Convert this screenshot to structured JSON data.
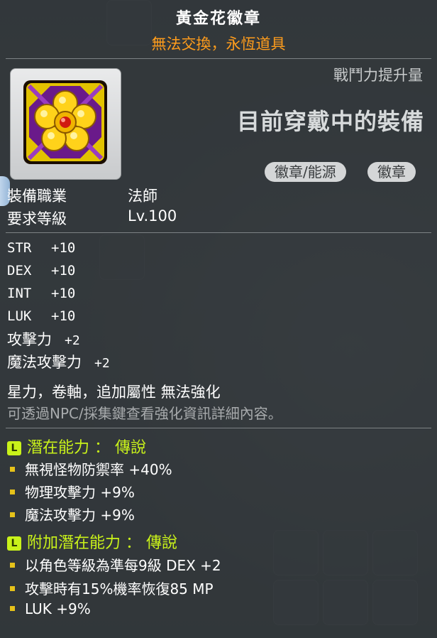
{
  "item": {
    "name": "黃金花徽章",
    "trade_note": "無法交換，永恆道具",
    "combat_power_label": "戰鬥力提升量",
    "equipped_label": "目前穿戴中的裝備",
    "tags": [
      "徽章/能源",
      "徽章"
    ]
  },
  "requirements": {
    "job_label": "裝備職業",
    "job_value": "法師",
    "level_label": "要求等級",
    "level_value": "Lv.100"
  },
  "stats": [
    {
      "name": "STR",
      "value": "+10"
    },
    {
      "name": "DEX",
      "value": "+10"
    },
    {
      "name": "INT",
      "value": "+10"
    },
    {
      "name": "LUK",
      "value": "+10"
    }
  ],
  "stats_cjk": [
    {
      "name": "攻擊力",
      "value": "+2"
    },
    {
      "name": "魔法攻擊力",
      "value": "+2"
    }
  ],
  "notes": {
    "enhance": "星力，卷軸，追加屬性 無法強化",
    "hint": "可透過NPC/採集鍵查看強化資訊詳細內容。"
  },
  "potential": {
    "badge": "L",
    "header": "潛在能力 ： 傳說",
    "lines": [
      "無視怪物防禦率 +40%",
      "物理攻擊力 +9%",
      "魔法攻擊力 +9%"
    ]
  },
  "bonus_potential": {
    "badge": "L",
    "header": "附加潛在能力 ： 傳說",
    "lines": [
      "以角色等級為準每9級 DEX +2",
      "攻擊時有15%機率恢復85 MP",
      "LUK +9%"
    ]
  },
  "colors": {
    "title": "#ffffff",
    "trade_note": "#ff9d1c",
    "legendary": "#c9f21a",
    "bullet": "#e6c21a"
  },
  "icons": {
    "item_icon": "golden-flower-badge-icon",
    "bullet": "square-bullet-icon",
    "legendary_badge": "legendary-grade-icon"
  }
}
